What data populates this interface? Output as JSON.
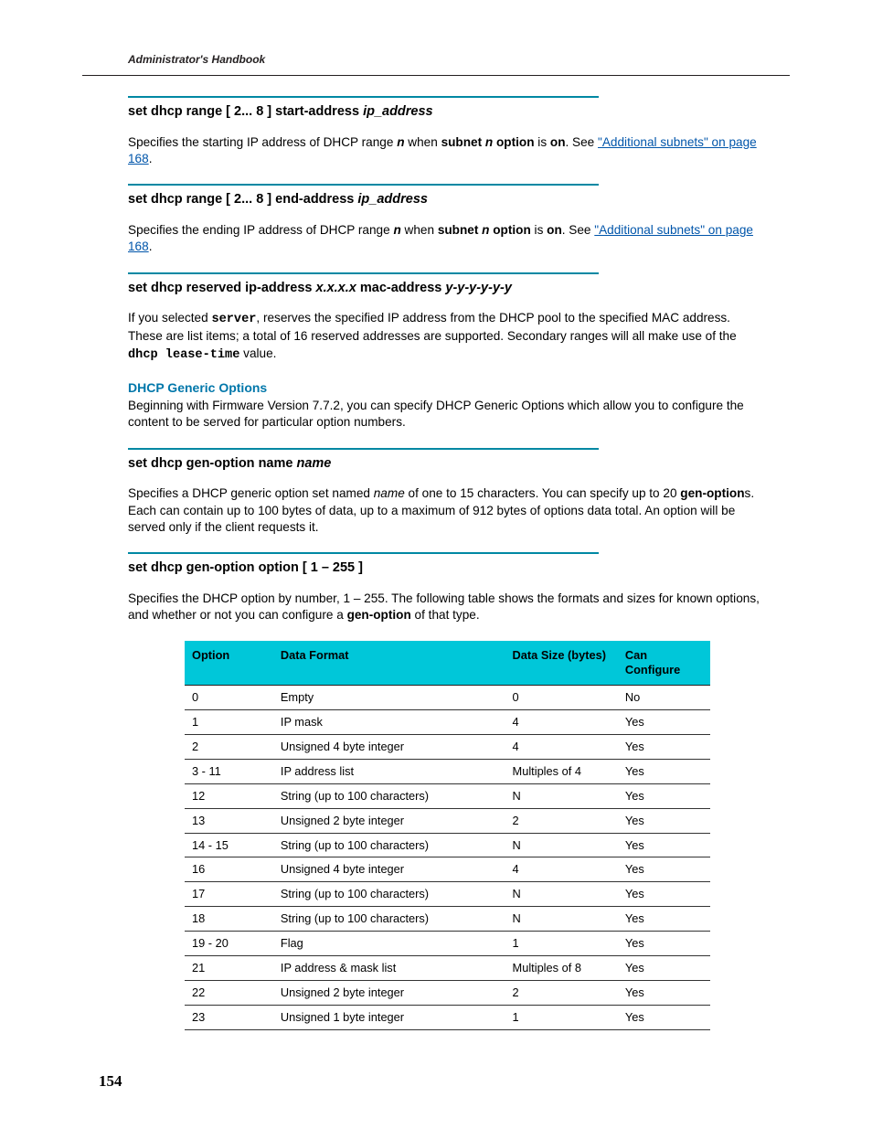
{
  "running_header": "Administrator's Handbook",
  "page_number": "154",
  "sections": {
    "start_addr": {
      "heading_prefix": "set dhcp range [ 2... 8 ] start-address ",
      "heading_param": "ip_address",
      "body_1a": "Specifies the starting IP address of DHCP range ",
      "body_n": "n",
      "body_1b": " when ",
      "body_subnet": "subnet ",
      "body_option": " option",
      "body_is": " is ",
      "body_on": "on",
      "body_see": ". See ",
      "body_link": "\"Additional subnets\" on page 168",
      "body_dot": "."
    },
    "end_addr": {
      "heading_prefix": "set dhcp range [ 2... 8 ] end-address ",
      "heading_param": "ip_address",
      "body_1a": "Specifies the ending IP address of DHCP range ",
      "body_n": "n",
      "body_1b": " when ",
      "body_subnet": "subnet ",
      "body_option": " option",
      "body_is": " is ",
      "body_on": "on",
      "body_see": ". See ",
      "body_link": "\"Additional subnets\" on page 168",
      "body_dot": "."
    },
    "reserved": {
      "heading_a": "set dhcp reserved ip-address ",
      "heading_x": "x.x.x.x",
      "heading_b": " mac-address ",
      "heading_y": "y-y-y-y-y-y",
      "body_a": "If you selected ",
      "body_server": "server",
      "body_b": ", reserves the specified IP address from the DHCP pool to the specified MAC address. These are list items; a total of 16 reserved addresses are supported. Secondary ranges will all make use of the ",
      "body_lease": "dhcp lease-time",
      "body_c": " value."
    },
    "generic_hdr": {
      "title": "DHCP Generic Options",
      "body": "Beginning with Firmware Version 7.7.2, you can specify DHCP Generic Options which allow you to configure the content to be served for particular option numbers."
    },
    "genopt_name": {
      "heading_prefix": "set dhcp gen-option name ",
      "heading_param": "name",
      "body_a": "Specifies a DHCP generic option set named ",
      "body_name": "name",
      "body_b": " of one to 15 characters. You can specify up to 20 ",
      "body_genopt": "gen-option",
      "body_c": "s. Each can contain up to 100 bytes of data, up to a maximum of 912 bytes of options data total. An option will be served only if the client requests it."
    },
    "genopt_option": {
      "heading": "set dhcp gen-option option [ 1 – 255 ]",
      "body_a": "Specifies the DHCP option by number, 1 – 255. The following table shows the formats and sizes for known options, and whether or not you can configure a ",
      "body_genopt": "gen-option",
      "body_b": " of that type."
    }
  },
  "table": {
    "headers": {
      "opt": "Option",
      "fmt": "Data Format",
      "size": "Data Size (bytes)",
      "conf": "Can Configure"
    },
    "rows": [
      {
        "opt": "0",
        "fmt": "Empty",
        "size": "0",
        "conf": "No"
      },
      {
        "opt": "1",
        "fmt": "IP mask",
        "size": "4",
        "conf": "Yes"
      },
      {
        "opt": "2",
        "fmt": "Unsigned 4 byte integer",
        "size": "4",
        "conf": "Yes"
      },
      {
        "opt": "3 - 11",
        "fmt": "IP address list",
        "size": "Multiples of 4",
        "conf": "Yes"
      },
      {
        "opt": "12",
        "fmt": "String (up to 100 characters)",
        "size": "N",
        "conf": "Yes"
      },
      {
        "opt": "13",
        "fmt": "Unsigned 2 byte integer",
        "size": "2",
        "conf": "Yes"
      },
      {
        "opt": "14 - 15",
        "fmt": "String (up to 100 characters)",
        "size": "N",
        "conf": "Yes"
      },
      {
        "opt": "16",
        "fmt": "Unsigned 4 byte integer",
        "size": "4",
        "conf": "Yes"
      },
      {
        "opt": "17",
        "fmt": "String (up to 100 characters)",
        "size": "N",
        "conf": "Yes"
      },
      {
        "opt": "18",
        "fmt": "String (up to 100 characters)",
        "size": "N",
        "conf": "Yes"
      },
      {
        "opt": "19 - 20",
        "fmt": "Flag",
        "size": "1",
        "conf": "Yes"
      },
      {
        "opt": "21",
        "fmt": "IP address & mask list",
        "size": "Multiples of 8",
        "conf": "Yes"
      },
      {
        "opt": "22",
        "fmt": "Unsigned 2 byte integer",
        "size": "2",
        "conf": "Yes"
      },
      {
        "opt": "23",
        "fmt": "Unsigned 1 byte integer",
        "size": "1",
        "conf": "Yes"
      }
    ]
  }
}
